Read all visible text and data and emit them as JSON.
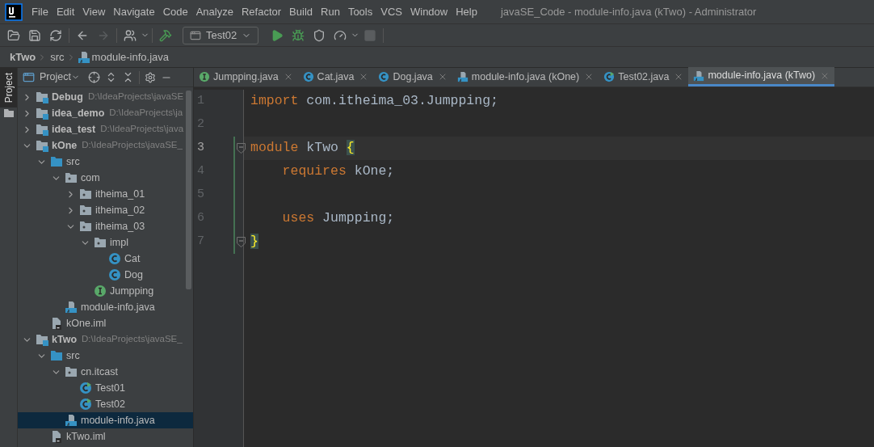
{
  "menu": [
    "File",
    "Edit",
    "View",
    "Navigate",
    "Code",
    "Analyze",
    "Refactor",
    "Build",
    "Run",
    "Tools",
    "VCS",
    "Window",
    "Help"
  ],
  "window": {
    "title": "javaSE_Code - module-info.java (kTwo) - Administrator"
  },
  "toolbar": {
    "left": [
      {
        "kind": "open",
        "disabled": false
      },
      {
        "kind": "save",
        "disabled": false
      },
      {
        "kind": "sync",
        "disabled": false
      },
      {
        "kind": "back",
        "disabled": false
      },
      {
        "kind": "forward",
        "disabled": true
      },
      {
        "kind": "user",
        "disabled": false
      },
      {
        "kind": "build",
        "disabled": false
      }
    ],
    "run_config": {
      "label": "Test02"
    },
    "right": [
      {
        "kind": "run",
        "disabled": false
      },
      {
        "kind": "debug",
        "disabled": false
      },
      {
        "kind": "coverage",
        "disabled": false
      },
      {
        "kind": "profile",
        "disabled": false
      },
      {
        "kind": "stop",
        "disabled": true
      }
    ]
  },
  "breadcrumb": [
    {
      "label": "kTwo",
      "kind": "module"
    },
    {
      "label": "src",
      "kind": "folder"
    },
    {
      "label": "module-info.java",
      "kind": "module_info"
    }
  ],
  "side_strip": {
    "label": "Project",
    "selected": true
  },
  "project_panel": {
    "title": "Project",
    "tree": [
      {
        "label": "Debug",
        "path": "D:\\IdeaProjects\\javaSE",
        "kind": "module",
        "expanded": false,
        "selected": false
      },
      {
        "label": "idea_demo",
        "path": "D:\\IdeaProjects\\ja",
        "kind": "module",
        "expanded": false,
        "selected": false
      },
      {
        "label": "idea_test",
        "path": "D:\\IdeaProjects\\java",
        "kind": "module",
        "expanded": false,
        "selected": false
      },
      {
        "label": "kOne",
        "path": "D:\\IdeaProjects\\javaSE_",
        "kind": "module",
        "expanded": true,
        "selected": false,
        "children": [
          {
            "label": "src",
            "kind": "source",
            "expanded": true,
            "selected": false,
            "children": [
              {
                "label": "com",
                "kind": "package",
                "expanded": true,
                "selected": false,
                "children": [
                  {
                    "label": "itheima_01",
                    "kind": "package",
                    "expanded": false,
                    "selected": false
                  },
                  {
                    "label": "itheima_02",
                    "kind": "package",
                    "expanded": false,
                    "selected": false
                  },
                  {
                    "label": "itheima_03",
                    "kind": "package",
                    "expanded": true,
                    "selected": false,
                    "children": [
                      {
                        "label": "impl",
                        "kind": "package",
                        "expanded": true,
                        "selected": false,
                        "children": [
                          {
                            "label": "Cat",
                            "kind": "class",
                            "selected": false
                          },
                          {
                            "label": "Dog",
                            "kind": "class",
                            "selected": false
                          }
                        ]
                      },
                      {
                        "label": "Jumpping",
                        "kind": "interface",
                        "selected": false
                      }
                    ]
                  }
                ]
              },
              {
                "label": "module-info.java",
                "kind": "module_info",
                "selected": false
              }
            ]
          },
          {
            "label": "kOne.iml",
            "kind": "iml",
            "selected": false
          }
        ]
      },
      {
        "label": "kTwo",
        "path": "D:\\IdeaProjects\\javaSE_",
        "kind": "module",
        "expanded": true,
        "selected": false,
        "children": [
          {
            "label": "src",
            "kind": "source",
            "expanded": true,
            "selected": false,
            "children": [
              {
                "label": "cn.itcast",
                "kind": "package",
                "expanded": true,
                "selected": false,
                "children": [
                  {
                    "label": "Test01",
                    "kind": "class_main",
                    "selected": false
                  },
                  {
                    "label": "Test02",
                    "kind": "class_main",
                    "selected": false
                  }
                ]
              },
              {
                "label": "module-info.java",
                "kind": "module_info",
                "selected": true
              }
            ]
          },
          {
            "label": "kTwo.iml",
            "kind": "iml",
            "selected": false
          }
        ]
      }
    ]
  },
  "tabs": [
    {
      "label": "Jumpping.java",
      "kind": "interface",
      "selected": false
    },
    {
      "label": "Cat.java",
      "kind": "class",
      "selected": false
    },
    {
      "label": "Dog.java",
      "kind": "class",
      "selected": false
    },
    {
      "label": "module-info.java (kOne)",
      "kind": "module_info",
      "selected": false
    },
    {
      "label": "Test02.java",
      "kind": "class_main",
      "selected": false
    },
    {
      "label": "module-info.java (kTwo)",
      "kind": "module_info",
      "selected": true
    }
  ],
  "editor": {
    "lines": [
      {
        "number": "1",
        "current": false,
        "fold": false,
        "changed": false,
        "tokens": [
          {
            "text": "import",
            "kind": "keyword"
          },
          {
            "text": " com.itheima_03.Jumpping;",
            "kind": "plain"
          }
        ]
      },
      {
        "number": "2",
        "current": false,
        "fold": false,
        "changed": false
      },
      {
        "number": "3",
        "current": true,
        "fold": true,
        "changed": true,
        "tokens": [
          {
            "text": "module",
            "kind": "keyword"
          },
          {
            "text": " kTwo ",
            "kind": "plain"
          },
          {
            "text": "{",
            "kind": "brace_match"
          }
        ]
      },
      {
        "number": "4",
        "current": false,
        "fold": false,
        "changed": true,
        "tokens": [
          {
            "text": "    requires",
            "kind": "keyword"
          },
          {
            "text": " kOne;",
            "kind": "plain"
          }
        ]
      },
      {
        "number": "5",
        "current": false,
        "fold": false,
        "changed": true
      },
      {
        "number": "6",
        "current": false,
        "fold": false,
        "changed": true,
        "tokens": [
          {
            "text": "    uses",
            "kind": "keyword"
          },
          {
            "text": " Jumpping;",
            "kind": "plain"
          }
        ]
      },
      {
        "number": "7",
        "current": false,
        "fold": true,
        "changed": true,
        "tokens": [
          {
            "text": "}",
            "kind": "brace_match"
          }
        ]
      }
    ]
  }
}
